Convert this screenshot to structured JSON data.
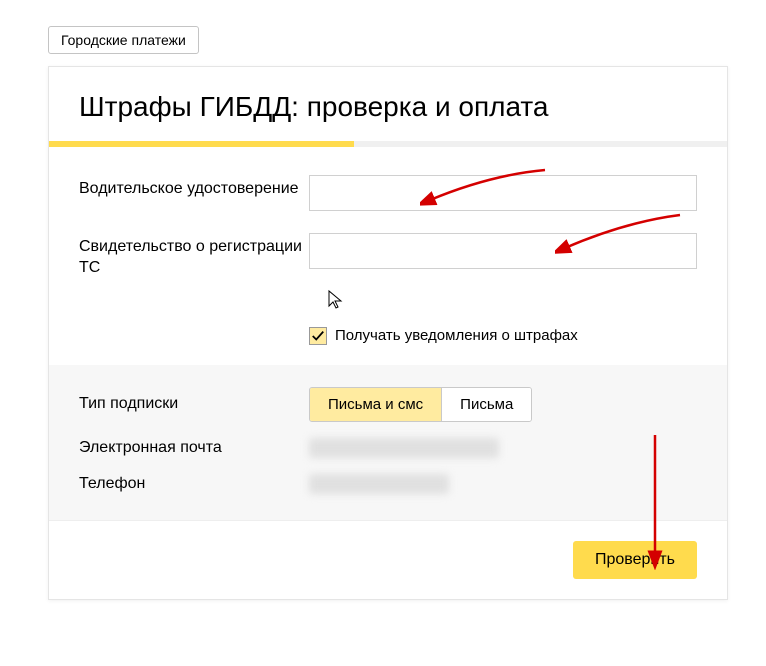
{
  "breadcrumb": {
    "label": "Городские платежи"
  },
  "page": {
    "title": "Штрафы ГИБДД: проверка и оплата"
  },
  "form": {
    "driver_license_label": "Водительское удостоверение",
    "driver_license_value": "",
    "registration_label": "Свидетельство о регистрации ТС",
    "registration_value": "",
    "notifications_label": "Получать уведомления о штрафах",
    "notifications_checked": true
  },
  "subscription": {
    "type_label": "Тип подписки",
    "options": [
      "Письма и смс",
      "Письма"
    ],
    "selected_index": 0,
    "email_label": "Электронная почта",
    "phone_label": "Телефон"
  },
  "footer": {
    "submit_label": "Проверить"
  }
}
